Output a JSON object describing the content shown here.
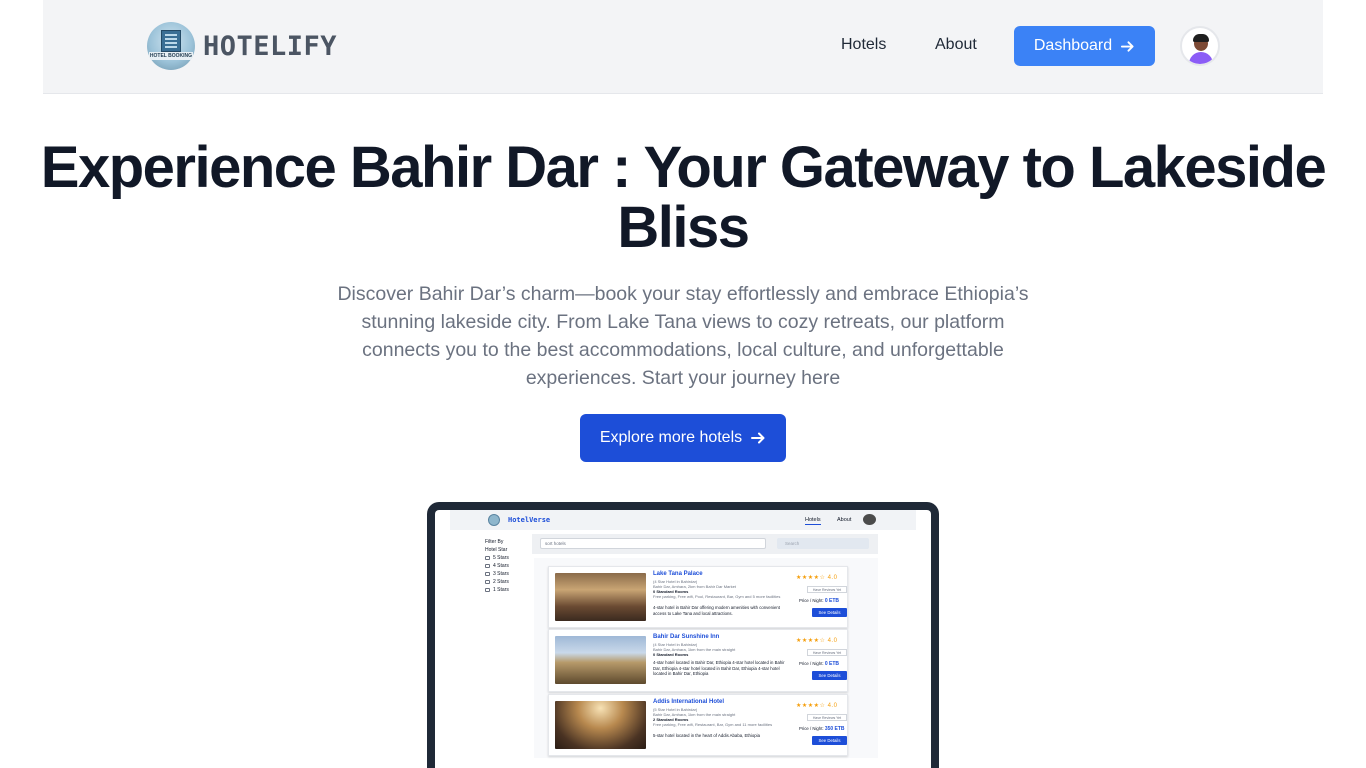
{
  "nav": {
    "logo_badge_text": "HOTEL BOOKING",
    "brand": "HOTELIFY",
    "links": [
      "Hotels",
      "About"
    ],
    "dashboard_label": "Dashboard",
    "dashboard_icon": "arrow-right-icon"
  },
  "hero": {
    "title": "Experience Bahir Dar : Your Gateway to Lakeside Bliss",
    "subtitle": "Discover Bahir Dar’s charm—book your stay effortlessly and embrace Ethiopia’s stunning lakeside city. From Lake Tana views to cozy retreats, our platform connects you to the best accommodations, local culture, and unforgettable experiences. Start your journey here",
    "cta_label": "Explore more hotels",
    "cta_icon": "arrow-right-icon"
  },
  "preview": {
    "brand": "HotelVerse",
    "nav_links": [
      "Hotels",
      "About"
    ],
    "filter_title_1": "Filter By",
    "filter_title_2": "Hotel Star",
    "filter_options": [
      "5 Stars",
      "4 Stars",
      "3 Stars",
      "2 Stars",
      "1 Stars"
    ],
    "sort_placeholder": "sort hotels",
    "search_placeholder": "Search",
    "hotels": [
      {
        "name": "Lake Tana Palace",
        "class": "(4 Star Hotel in Bahirdar)",
        "location": "Bahir Dar, Amhara, 2km from Bahir Dar Market",
        "rooms": "0 Standard Rooms",
        "amenities": "Free parking, Free wifi, Pool, Restaurant, Bar, Gym and 5 more facilities",
        "description": "4-star hotel in Bahir Dar offering modern amenities with convenient access to Lake Tana and local attractions.",
        "stars": "★★★★☆",
        "rating": "4.0",
        "reviews": "Have Reviews Yet",
        "price_label": "Price / Night:",
        "price": "0 ETB",
        "button": "See Details"
      },
      {
        "name": "Bahir Dar Sunshine Inn",
        "class": "(4 Star Hotel in Bahirdar)",
        "location": "Bahir Dar, Amhara, 1km from the main straight",
        "rooms": "0 Standard Rooms",
        "amenities": "",
        "description": "4-star hotel located in Bahir Dar, Ethiopia 4-star hotel located in Bahir Dar, Ethiopia 4-star hotel located in Bahir Dar, Ethiopia 4-star hotel located in Bahir Dar, Ethiopia",
        "stars": "★★★★☆",
        "rating": "4.0",
        "reviews": "Have Reviews Yet",
        "price_label": "Price / Night:",
        "price": "0 ETB",
        "button": "See Details"
      },
      {
        "name": "Addis International Hotel",
        "class": "(5 Star Hotel in Bahirdar)",
        "location": "Bahir Dar, Amhara, 1km from the main straight",
        "rooms": "2 Standard Rooms",
        "amenities": "Free parking, Free wifi, Restaurant, Bar, Gym and 11 more facilities",
        "description": "5-star hotel located in the heart of Addis Ababa, Ethiopia",
        "stars": "★★★★☆",
        "rating": "4.0",
        "reviews": "Have Reviews Yet",
        "price_label": "Price / Night:",
        "price": "350 ETB",
        "button": "See Details"
      }
    ]
  },
  "colors": {
    "primary": "#3b82f6",
    "primary_dark": "#1d4ed8",
    "nav_bg": "#f3f4f6",
    "title": "#111827",
    "subtitle": "#6b7280"
  }
}
